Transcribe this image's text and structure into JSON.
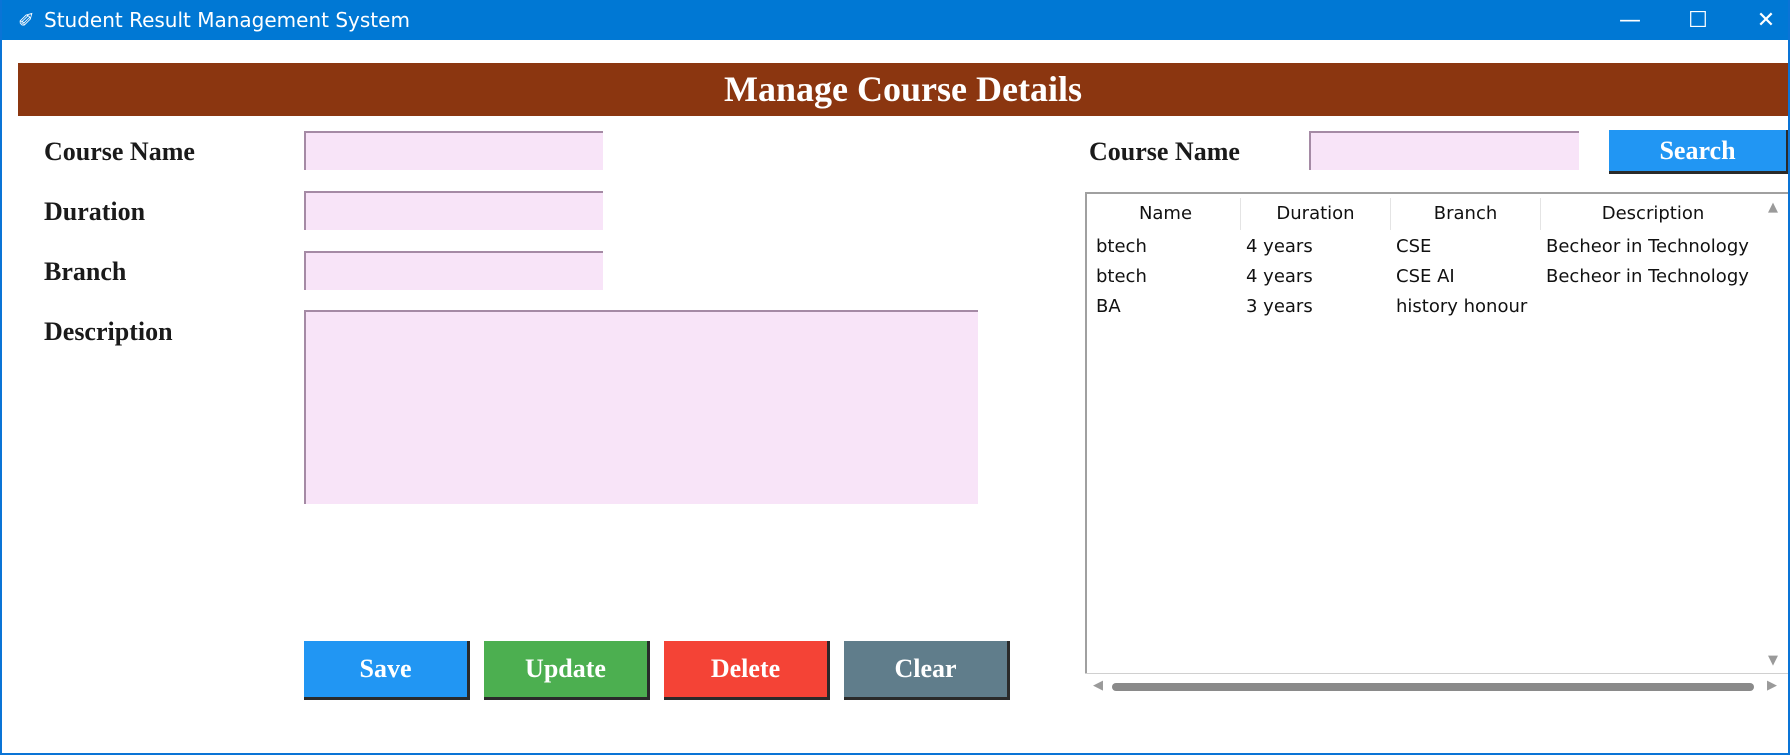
{
  "window": {
    "title": "Student Result Management System",
    "minimize_glyph": "—",
    "maximize_glyph": "☐",
    "close_glyph": "✕"
  },
  "header": {
    "title": "Manage Course Details"
  },
  "form": {
    "course_name_label": "Course Name",
    "course_name_value": "",
    "duration_label": "Duration",
    "duration_value": "",
    "branch_label": "Branch",
    "branch_value": "",
    "description_label": "Description",
    "description_value": ""
  },
  "buttons": {
    "save": "Save",
    "update": "Update",
    "delete": "Delete",
    "clear": "Clear"
  },
  "search": {
    "label": "Course Name",
    "value": "",
    "button": "Search"
  },
  "table": {
    "columns": [
      "Name",
      "Duration",
      "Branch",
      "Description"
    ],
    "rows": [
      [
        "btech",
        "4 years",
        "CSE",
        "Becheor in Technology"
      ],
      [
        "btech",
        "4 years",
        "CSE AI",
        "Becheor in Technology"
      ],
      [
        "BA",
        "3 years",
        "history honour",
        ""
      ]
    ]
  },
  "colors": {
    "titlebar": "#0078d4",
    "header": "#8b3610",
    "field_bg": "#f8e4f8",
    "save": "#2196f3",
    "update": "#4caf50",
    "delete": "#f44336",
    "clear": "#607d8b",
    "search": "#2196f3"
  },
  "icons": {
    "app": "feather-icon",
    "scroll_up": "chevron-up-icon",
    "scroll_down": "chevron-down-icon",
    "scroll_left": "chevron-left-icon",
    "scroll_right": "chevron-right-icon"
  }
}
